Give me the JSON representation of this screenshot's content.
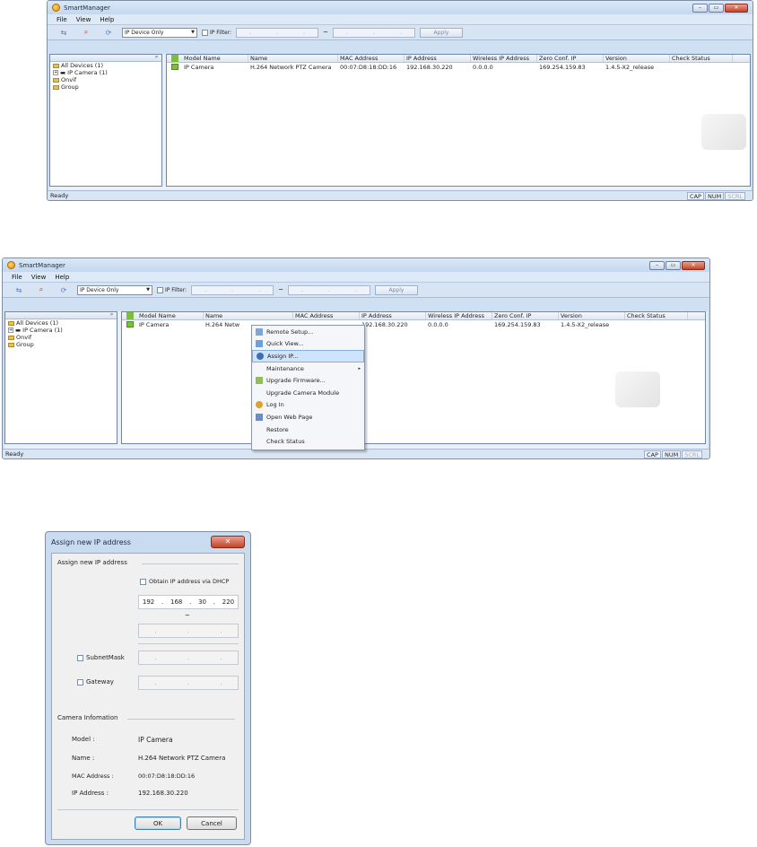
{
  "app": {
    "title": "SmartManager"
  },
  "window_controls": {
    "minimize": "–",
    "maximize": "▭",
    "close": "✕"
  },
  "menu": [
    "File",
    "View",
    "Help"
  ],
  "toolbar": {
    "filter_select": "IP Device Only",
    "ip_filter_label": "IP Filter:",
    "ip_dots": [
      ".",
      ".",
      "."
    ],
    "range_sep": "~",
    "apply": "Apply"
  },
  "tree": {
    "pin": "ᵖ",
    "items": [
      "All Devices (1)",
      "IP Camera (1)",
      "Onvif",
      "Group"
    ]
  },
  "grid": {
    "columns": [
      "Model Name",
      "Name",
      "MAC Address",
      "IP Address",
      "Wireless IP Address",
      "Zero Conf. IP",
      "Version",
      "Check Status"
    ],
    "rows": [
      {
        "model": "IP Camera",
        "name": "H.264 Network PTZ Camera",
        "mac": "00:07:D8:18:DD:16",
        "ip": "192.168.30.220",
        "wireless": "0.0.0.0",
        "zeroconf": "169.254.159.83",
        "version": "1.4.5-X2_release",
        "status": ""
      }
    ],
    "row_truncated_name": "H.264 Netw"
  },
  "status": {
    "text": "Ready",
    "cap": "CAP",
    "num": "NUM",
    "scrl": "SCRL"
  },
  "context_menu": {
    "items": [
      "Remote Setup...",
      "Quick View...",
      "Assign IP...",
      "Maintenance",
      "Upgrade Firmware...",
      "Upgrade Camera Module",
      "Log In",
      "Open Web Page",
      "Restore",
      "Check Status"
    ],
    "highlighted": "Assign IP...",
    "submenu_arrow": "▸"
  },
  "dialog": {
    "title": "Assign new IP address",
    "close": "✕",
    "section_assign": "Assign new IP address",
    "dhcp_label": "Obtain IP address via DHCP",
    "ip_from": [
      "192",
      "168",
      "30",
      "220"
    ],
    "range_sep": "~",
    "subnet_label": "SubnetMask",
    "gateway_label": "Gateway",
    "section_info": "Camera Infomation",
    "info": [
      {
        "label": "Model :",
        "value": "IP Camera"
      },
      {
        "label": "Name :",
        "value": "H.264 Network PTZ Camera"
      },
      {
        "label": "MAC Address :",
        "value": "00:07:D8:18:DD:16"
      },
      {
        "label": "IP Address :",
        "value": "192.168.30.220"
      }
    ],
    "ok": "OK",
    "cancel": "Cancel"
  },
  "colors": {
    "accent": "#7cbf3a",
    "highlight": "#cfe3fa",
    "close": "#c4432a"
  }
}
